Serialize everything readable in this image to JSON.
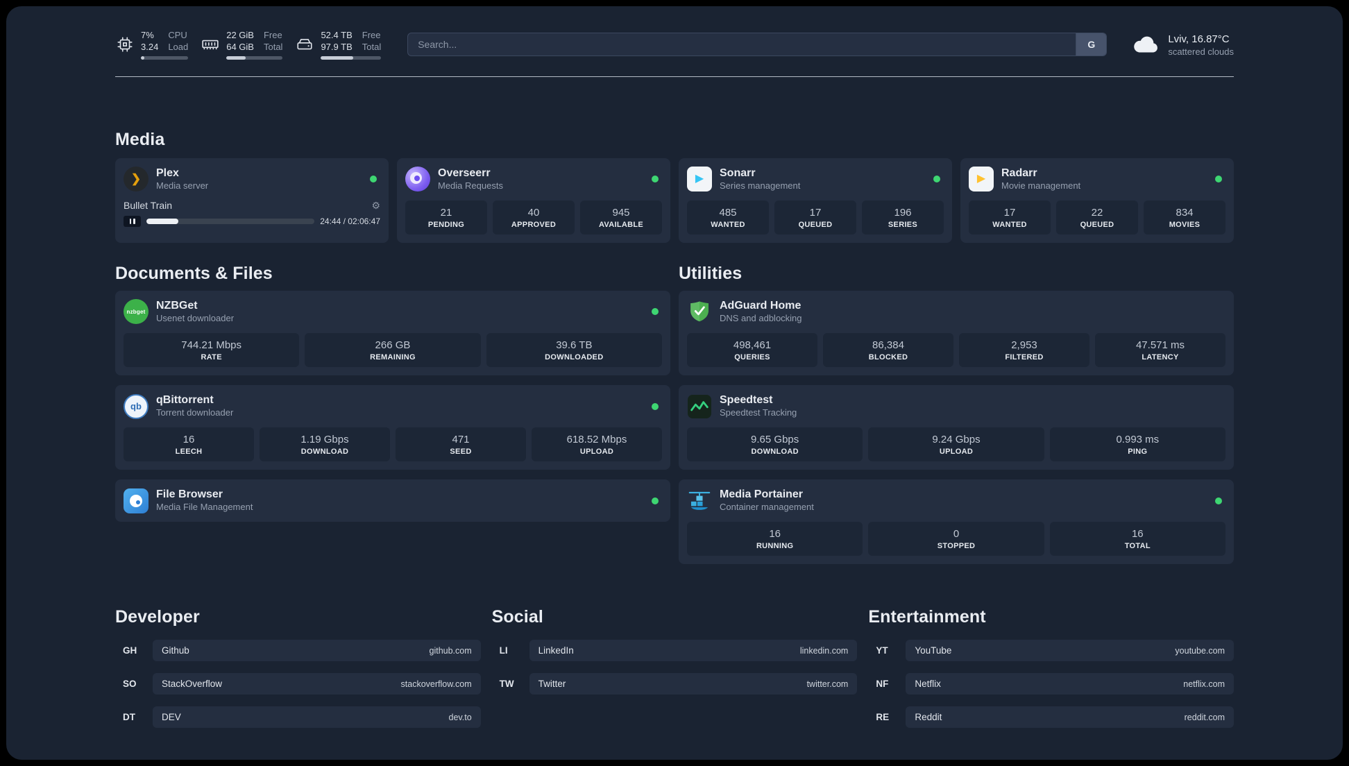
{
  "colors": {
    "status_online": "#3ed672"
  },
  "icons": {
    "plex_glyph": "❯",
    "sonarr_glyph": "▶",
    "radarr_glyph": "▶",
    "nzbget_text": "nzbget",
    "qbittorrent_text": "qb",
    "gear_glyph": "⚙"
  },
  "topbar": {
    "cpu": {
      "value1": "7%",
      "value2": "3.24",
      "label1": "CPU",
      "label2": "Load",
      "progress_percent": 8
    },
    "memory": {
      "value1": "22 GiB",
      "value2": "64 GiB",
      "label1": "Free",
      "label2": "Total",
      "progress_percent": 34
    },
    "disk": {
      "value1": "52.4 TB",
      "value2": "97.9 TB",
      "label1": "Free",
      "label2": "Total",
      "progress_percent": 54
    },
    "search": {
      "placeholder": "Search...",
      "provider_button": "G"
    },
    "weather": {
      "location": "Lviv, 16.87°C",
      "condition": "scattered clouds"
    }
  },
  "sections": {
    "media": {
      "title": "Media",
      "cards": [
        {
          "name": "Plex",
          "description": "Media server",
          "status": "online",
          "player": {
            "track": "Bullet Train",
            "time": "24:44 / 02:06:47",
            "progress_percent": 19
          }
        },
        {
          "name": "Overseerr",
          "description": "Media Requests",
          "status": "online",
          "stats": [
            {
              "value": "21",
              "label": "PENDING"
            },
            {
              "value": "40",
              "label": "APPROVED"
            },
            {
              "value": "945",
              "label": "AVAILABLE"
            }
          ]
        },
        {
          "name": "Sonarr",
          "description": "Series management",
          "status": "online",
          "stats": [
            {
              "value": "485",
              "label": "WANTED"
            },
            {
              "value": "17",
              "label": "QUEUED"
            },
            {
              "value": "196",
              "label": "SERIES"
            }
          ]
        },
        {
          "name": "Radarr",
          "description": "Movie management",
          "status": "online",
          "stats": [
            {
              "value": "17",
              "label": "WANTED"
            },
            {
              "value": "22",
              "label": "QUEUED"
            },
            {
              "value": "834",
              "label": "MOVIES"
            }
          ]
        }
      ]
    },
    "documents": {
      "title": "Documents & Files",
      "cards": [
        {
          "name": "NZBGet",
          "description": "Usenet downloader",
          "status": "online",
          "stats": [
            {
              "value": "744.21 Mbps",
              "label": "RATE"
            },
            {
              "value": "266 GB",
              "label": "REMAINING"
            },
            {
              "value": "39.6 TB",
              "label": "DOWNLOADED"
            }
          ]
        },
        {
          "name": "qBittorrent",
          "description": "Torrent downloader",
          "status": "online",
          "stats": [
            {
              "value": "16",
              "label": "LEECH"
            },
            {
              "value": "1.19 Gbps",
              "label": "DOWNLOAD"
            },
            {
              "value": "471",
              "label": "SEED"
            },
            {
              "value": "618.52 Mbps",
              "label": "UPLOAD"
            }
          ]
        },
        {
          "name": "File Browser",
          "description": "Media File Management",
          "status": "online"
        }
      ]
    },
    "utilities": {
      "title": "Utilities",
      "cards": [
        {
          "name": "AdGuard Home",
          "description": "DNS and adblocking",
          "stats": [
            {
              "value": "498,461",
              "label": "QUERIES"
            },
            {
              "value": "86,384",
              "label": "BLOCKED"
            },
            {
              "value": "2,953",
              "label": "FILTERED"
            },
            {
              "value": "47.571 ms",
              "label": "LATENCY"
            }
          ]
        },
        {
          "name": "Speedtest",
          "description": "Speedtest Tracking",
          "stats": [
            {
              "value": "9.65 Gbps",
              "label": "DOWNLOAD"
            },
            {
              "value": "9.24 Gbps",
              "label": "UPLOAD"
            },
            {
              "value": "0.993 ms",
              "label": "PING"
            }
          ]
        },
        {
          "name": "Media Portainer",
          "description": "Container management",
          "status": "online",
          "stats": [
            {
              "value": "16",
              "label": "RUNNING"
            },
            {
              "value": "0",
              "label": "STOPPED"
            },
            {
              "value": "16",
              "label": "TOTAL"
            }
          ]
        }
      ]
    },
    "bookmarks": [
      {
        "title": "Developer",
        "items": [
          {
            "abbr": "GH",
            "name": "Github",
            "domain": "github.com"
          },
          {
            "abbr": "SO",
            "name": "StackOverflow",
            "domain": "stackoverflow.com"
          },
          {
            "abbr": "DT",
            "name": "DEV",
            "domain": "dev.to"
          }
        ]
      },
      {
        "title": "Social",
        "items": [
          {
            "abbr": "LI",
            "name": "LinkedIn",
            "domain": "linkedin.com"
          },
          {
            "abbr": "TW",
            "name": "Twitter",
            "domain": "twitter.com"
          }
        ]
      },
      {
        "title": "Entertainment",
        "items": [
          {
            "abbr": "YT",
            "name": "YouTube",
            "domain": "youtube.com"
          },
          {
            "abbr": "NF",
            "name": "Netflix",
            "domain": "netflix.com"
          },
          {
            "abbr": "RE",
            "name": "Reddit",
            "domain": "reddit.com"
          }
        ]
      }
    ]
  }
}
